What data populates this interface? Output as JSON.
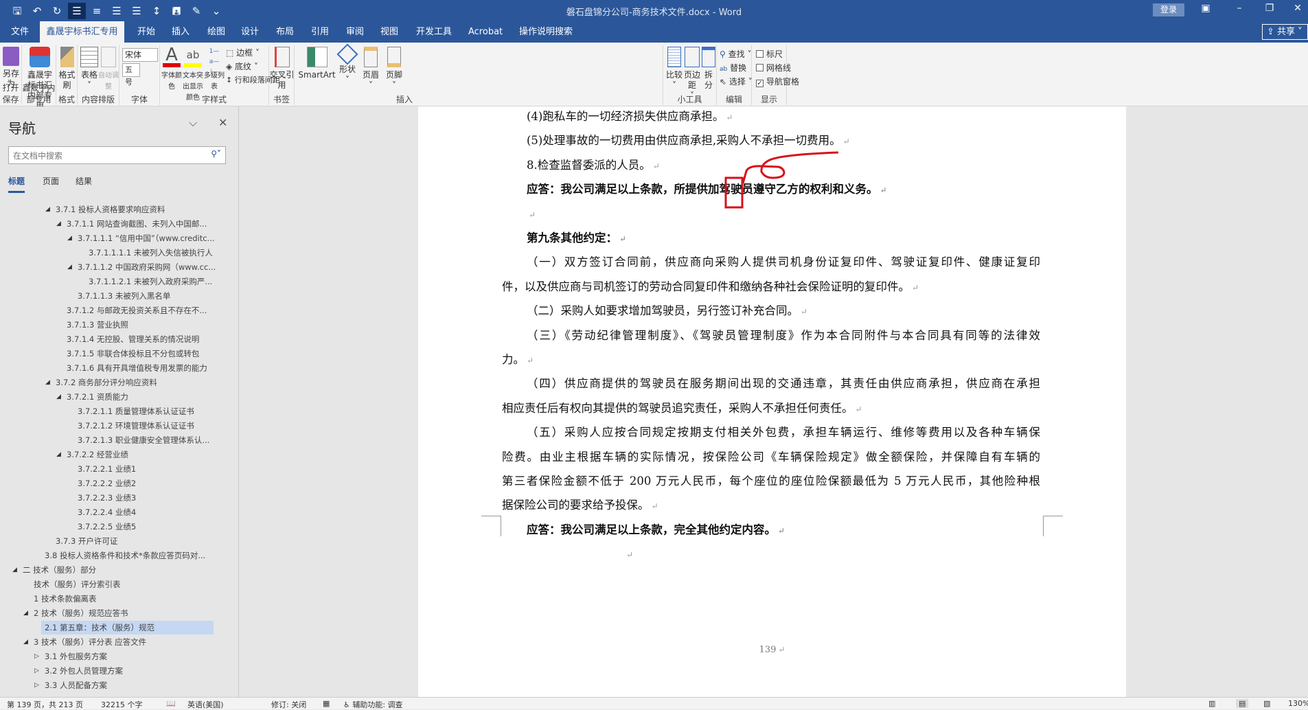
{
  "titlebar": {
    "title": "磐石盘锦分公司-商务技术文件.docx  -  Word",
    "login": "登录",
    "qat": [
      "save-icon",
      "undo-icon",
      "redo-icon",
      "align-left-icon",
      "align-center-icon",
      "align-right-icon",
      "justify-icon",
      "line-spacing-icon",
      "save-as-icon",
      "format-painter-icon",
      "customize-icon"
    ]
  },
  "tabs": [
    "文件",
    "鑫晟宇标书汇专用",
    "开始",
    "插入",
    "绘图",
    "设计",
    "布局",
    "引用",
    "审阅",
    "视图",
    "开发工具",
    "Acrobat",
    "操作说明搜索"
  ],
  "share": "共享",
  "ribbon": {
    "groups": [
      "打开保存",
      "鑫晟宇内部专用",
      "格式",
      "内容排版",
      "字体",
      "字样式",
      "书签",
      "插入",
      "小工具",
      "编辑",
      "显示"
    ],
    "save_as": "另存为",
    "xsy": "鑫晟宇标书汇内部专用",
    "format_painter": "格式刷",
    "table": "表格",
    "autofit": "自动调整",
    "font_name": "宋体",
    "font_size": "五号",
    "font_color": "字体颜色",
    "highlight": "文本突出显示颜色",
    "multilevel": "多级列表",
    "border": "边框",
    "shading": "底纹",
    "spacing": "行和段落间距",
    "crossref": "交叉引用",
    "smartart": "SmartArt",
    "shape": "形状",
    "header": "页眉",
    "footer": "页脚",
    "compare": "比较",
    "margins": "页边距",
    "split": "拆分",
    "find": "查找",
    "replace": "替换",
    "select": "选择",
    "ruler": "标尺",
    "gridlines": "网格线",
    "navpane": "导航窗格",
    "ruler_checked": false,
    "grid_checked": false,
    "nav_checked": true,
    "colors": {
      "font_color": "#e00000",
      "highlight": "#ffff00"
    }
  },
  "nav": {
    "title": "导航",
    "search_placeholder": "在文档中搜索",
    "tabs": [
      "标题",
      "页面",
      "结果"
    ],
    "items": [
      {
        "t": "3.7.1 投标人资格要求响应资料",
        "l": 3,
        "e": "down"
      },
      {
        "t": "3.7.1.1 网站查询截图、未列入中国邮...",
        "l": 4,
        "e": "down"
      },
      {
        "t": "3.7.1.1.1 “信用中国”（www.creditc...",
        "l": 5,
        "e": "down"
      },
      {
        "t": "3.7.1.1.1.1 未被列入失信被执行人",
        "l": 6
      },
      {
        "t": "3.7.1.1.2 中国政府采购网（www.cc...",
        "l": 5,
        "e": "down"
      },
      {
        "t": "3.7.1.1.2.1 未被列入政府采购严...",
        "l": 6
      },
      {
        "t": "3.7.1.1.3 未被列入黑名单",
        "l": 5
      },
      {
        "t": "3.7.1.2 与邮政无投资关系且不存在不...",
        "l": 4
      },
      {
        "t": "3.7.1.3 营业执照",
        "l": 4
      },
      {
        "t": "3.7.1.4 无控股、管理关系的情况说明",
        "l": 4
      },
      {
        "t": "3.7.1.5 非联合体投标且不分包或转包",
        "l": 4
      },
      {
        "t": "3.7.1.6 具有开具增值税专用发票的能力",
        "l": 4
      },
      {
        "t": "3.7.2 商务部分评分响应资料",
        "l": 3,
        "e": "down"
      },
      {
        "t": "3.7.2.1 资质能力",
        "l": 4,
        "e": "down"
      },
      {
        "t": "3.7.2.1.1 质量管理体系认证证书",
        "l": 5
      },
      {
        "t": "3.7.2.1.2 环境管理体系认证证书",
        "l": 5
      },
      {
        "t": "3.7.2.1.3 职业健康安全管理体系认...",
        "l": 5
      },
      {
        "t": "3.7.2.2 经营业绩",
        "l": 4,
        "e": "down"
      },
      {
        "t": "3.7.2.2.1 业绩1",
        "l": 5
      },
      {
        "t": "3.7.2.2.2 业绩2",
        "l": 5
      },
      {
        "t": "3.7.2.2.3 业绩3",
        "l": 5
      },
      {
        "t": "3.7.2.2.4 业绩4",
        "l": 5
      },
      {
        "t": "3.7.2.2.5 业绩5",
        "l": 5
      },
      {
        "t": "3.7.3 开户许可证",
        "l": 3
      },
      {
        "t": "3.8 投标人资格条件和技术*条款应答页码对...",
        "l": 2
      },
      {
        "t": "二 技术（服务）部分",
        "l": 0,
        "e": "down"
      },
      {
        "t": "技术（服务）评分索引表",
        "l": 1
      },
      {
        "t": "1 技术条款偏离表",
        "l": 1
      },
      {
        "t": "2 技术（服务）规范应答书",
        "l": 1,
        "e": "down"
      },
      {
        "t": "2.1 第五章：技术（服务）规范",
        "l": 2,
        "sel": true
      },
      {
        "t": "3 技术（服务）评分表 应答文件",
        "l": 1,
        "e": "down"
      },
      {
        "t": "3.1 外包服务方案",
        "l": 2,
        "e": "right"
      },
      {
        "t": "3.2 外包人员管理方案",
        "l": 2,
        "e": "right"
      },
      {
        "t": "3.3 人员配备方案",
        "l": 2,
        "e": "right"
      }
    ]
  },
  "doc": {
    "lines": [
      {
        "t": "(4)跑私车的一切经济损失供应商承担。",
        "i": 1
      },
      {
        "t": "(5)处理事故的一切费用由供应商承担,采购人不承担一切费用。",
        "i": 1
      },
      {
        "t": "8.检查监督委派的人员。",
        "i": 1
      },
      {
        "t": "应答：我公司满足以上条款，所提供加驾驶员遵守乙方的权利和义务。",
        "i": 1,
        "b": true
      },
      {
        "t": "",
        "i": 1
      },
      {
        "t": "第九条其他约定：",
        "i": 1,
        "b": true
      },
      {
        "t": "（一）双方签订合同前，供应商向采购人提供司机身份证复印件、驾驶证复印件、健康证复印",
        "i": 1,
        "j": true,
        "nm": true
      },
      {
        "t": "件，以及供应商与司机签订的劳动合同复印件和缴纳各种社会保险证明的复印件。",
        "i": 0
      },
      {
        "t": "（二）采购人如要求增加驾驶员，另行签订补充合同。",
        "i": 1
      },
      {
        "t": "（三）《劳动纪律管理制度》、《驾驶员管理制度》作为本合同附件与本合同具有同等的法律效",
        "i": 1,
        "j": true,
        "nm": true
      },
      {
        "t": "力。",
        "i": 0
      },
      {
        "t": "（四）供应商提供的驾驶员在服务期间出现的交通违章，其责任由供应商承担，供应商在承担",
        "i": 1,
        "j": true,
        "nm": true
      },
      {
        "t": "相应责任后有权向其提供的驾驶员追究责任，采购人不承担任何责任。",
        "i": 0
      },
      {
        "t": "（五）采购人应按合同规定按期支付相关外包费，承担车辆运行、维修等费用以及各种车辆保",
        "i": 1,
        "j": true,
        "nm": true
      },
      {
        "t": "险费。由业主根据车辆的实际情况，按保险公司《车辆保险规定》做全额保险，并保障自有车辆的",
        "i": 0,
        "j": true,
        "nm": true
      },
      {
        "t": "第三者保险金额不低于 200 万元人民币，每个座位的座位险保额最低为 5 万元人民币，其他险种根",
        "i": 0,
        "j": true,
        "nm": true
      },
      {
        "t": "据保险公司的要求给予投保。",
        "i": 0
      },
      {
        "t": "应答：我公司满足以上条款，完全其他约定内容。",
        "i": 1,
        "b": true
      }
    ],
    "para_mark": "↵",
    "page_number": "139"
  },
  "status": {
    "page": "第 139 页，共 213 页",
    "words": "32215 个字",
    "lang": "英语(美国)",
    "track": "修订: 关闭",
    "access": "辅助功能: 调查",
    "zoom": "130%"
  }
}
